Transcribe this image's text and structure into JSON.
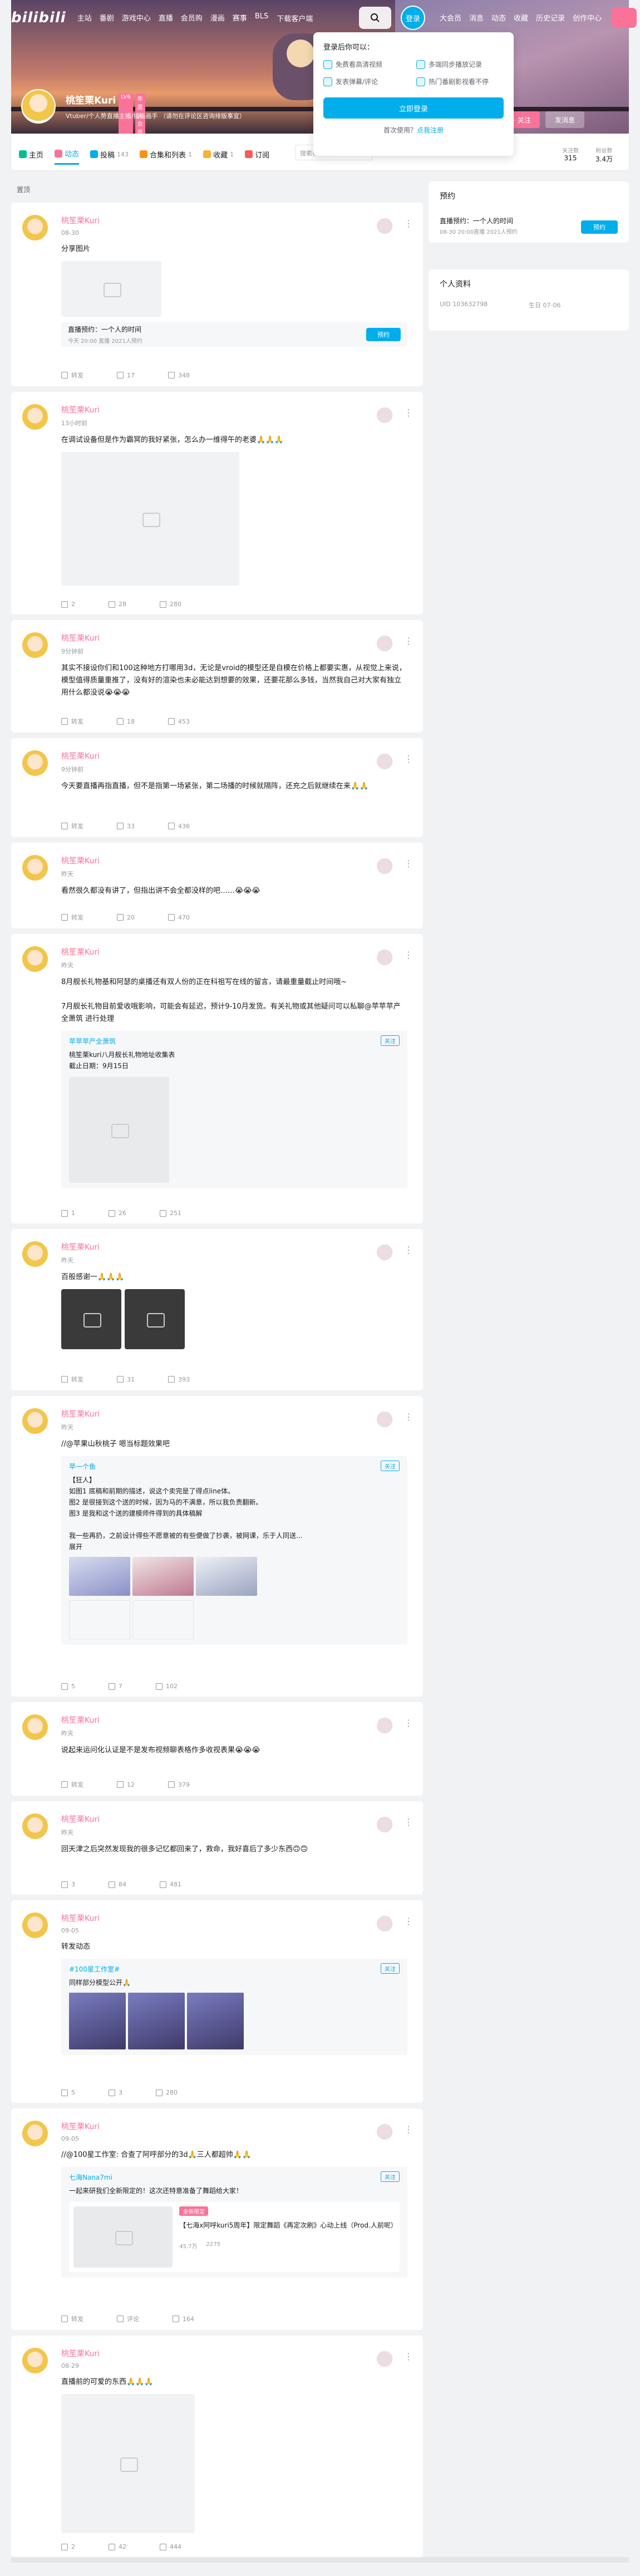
{
  "nav": {
    "logo": "bilibili",
    "links": [
      "主站",
      "番剧",
      "游戏中心",
      "直播",
      "会员购",
      "漫画",
      "赛事",
      "BLS"
    ],
    "download": "下载客户端",
    "login": "登录",
    "right": [
      "大会员",
      "消息",
      "动态",
      "收藏",
      "历史记录",
      "创作中心"
    ]
  },
  "profile": {
    "name": "桃笙栗Kuri",
    "level": "LV6",
    "vip": "年度大会员",
    "sign": "Vtuber/个人势直播主播/插画画手   （请勿在评论区咨询排版事宜）",
    "follow_label": "+ 关注",
    "message_label": "发消息"
  },
  "tabs": [
    {
      "name": "home",
      "label": "主页",
      "count": ""
    },
    {
      "name": "dynamic",
      "label": "动态",
      "count": ""
    },
    {
      "name": "video",
      "label": "投稿",
      "count": "143"
    },
    {
      "name": "collection",
      "label": "合集和列表",
      "count": "1"
    },
    {
      "name": "favorites",
      "label": "收藏",
      "count": "1"
    },
    {
      "name": "follow",
      "label": "订阅",
      "count": ""
    }
  ],
  "search_placeholder": "搜索视频、动态",
  "stats": [
    {
      "label": "关注数",
      "value": "315"
    },
    {
      "label": "粉丝数",
      "value": "3.4万"
    }
  ],
  "popup": {
    "title": "登录后你可以：",
    "items": [
      "免费看高清视频",
      "多端同步播放记录",
      "发表弹幕/评论",
      "热门番剧影视看不停"
    ],
    "button": "立即登录",
    "footer": "首次使用？",
    "footer_link": "点我注册"
  },
  "section_label": "置顶",
  "side": {
    "live_title": "预约",
    "live_item": "直播预约：一个人的时间",
    "live_time": "08-30 20:00直播  2021人预约",
    "live_button": "预约",
    "info_title": "个人资料",
    "uid": "UID 103632798",
    "birthday": "生日 07-06"
  },
  "posts": [
    {
      "time": "08-30",
      "text": "分享图片",
      "live": "直播预约：一个人的时间",
      "live_sub": "今天 20:00 直播  2021人预约",
      "live_btn": "预约",
      "f": [
        "转发",
        "17",
        "348"
      ]
    },
    {
      "time": "13小时前",
      "text": "在调试设备但是作为霸冥的我好紧张，怎么办一维得午的老婆🙏🙏🙏",
      "f": [
        "2",
        "28",
        "280"
      ]
    },
    {
      "time": "9分钟前",
      "text": "其实不接设你们和100这种地方打哪用3d，无论是vroid的模型还是自模在价格上都要实惠，从视觉上来说，模型值得质量重推了，没有好的渲染也未必能达到想要的效果，还要花那么多钱，当然我自己对大家有独立用什么都没说😭😭😭",
      "f": [
        "转发",
        "18",
        "453"
      ]
    },
    {
      "time": "9分钟前",
      "text": "今天要直播再指直播，但不是指第一场紧张，第二场播的时候就隔阵，还充之后就继续在来🙏🙏",
      "f": [
        "转发",
        "33",
        "436"
      ]
    },
    {
      "time": "昨天",
      "text": "看然很久都没有讲了，但指出讲不会全都没样的吧……😭😭😭",
      "f": [
        "转发",
        "20",
        "470"
      ]
    },
    {
      "time": "昨天",
      "text": "8月舰长礼物基和阿瑟的桌播还有双人份的正在科祖写在线的留言，请最重量截止时间哦~\n\n7月舰长礼物目前爱收哦影响，可能会有延迟，预计9-10月发货。有关礼物或其他疑问可以私聊@苹苹苹产全萧筑 进行处理",
      "repost_user": "苹苹苹产全萧筑",
      "repost_text": "桃笙栗kuri八月舰长礼物地址收集表\n截止日期：9月15日",
      "f": [
        "1",
        "26",
        "251"
      ]
    },
    {
      "time": "昨天",
      "text": "百般感谢一🙏🙏🙏",
      "f": [
        "转发",
        "31",
        "393"
      ]
    },
    {
      "time": "昨天",
      "text": "//@苹果山秋桃子 嗯当标题效果吧",
      "repost_user": "苹一个鱼",
      "repost_text": "【狂人】\n如图1 底稿和前期的描述，说这个卖完是了得点line体。\n图2 是很接到这个送的时候，因为马的不满意，所以我负责翻新。\n图3 是我和这个送的建模师件得到的具体稿解\n\n我一些再扔，之前设计得些不愿意被的有些便做了抄袭，被网课，乐于人同送...\n展开",
      "f": [
        "5",
        "7",
        "102"
      ]
    },
    {
      "time": "昨天",
      "text": "说起来运问化认证是不是发布视频聊表格作多收视表果😭😭😭",
      "f": [
        "转发",
        "12",
        "379"
      ]
    },
    {
      "time": "昨天",
      "text": "回天津之后突然发现我的很多记忆都回来了，救命，我好喜后了多少东西🙃🙃",
      "f": [
        "3",
        "84",
        "481"
      ]
    },
    {
      "time": "09-05",
      "text": "转发动态",
      "repost_user": "#100星工作室#",
      "repost_text": "同样部分模型公开🙏",
      "f": [
        "5",
        "3",
        "280"
      ]
    },
    {
      "time": "09-05",
      "text": "//@100星工作室: 合查了阿呼部分的3d🙏三人都超帅🙏🙏",
      "repost_user": "七海Nana7mi",
      "repost_text": "一起来研我们全新限定的！这次还特意准备了舞蹈给大家！",
      "inner_title": "【七海x阿呼kuri5周年】限定舞蹈《再定次刷》心动上线（Prod.人前呢）",
      "inner_tag": "全新限定",
      "inner_stats": [
        "45.7万",
        "2275"
      ],
      "f": [
        "转发",
        "评论",
        "164"
      ]
    },
    {
      "time": "08-29",
      "text": "直播前的可爱的东西🙏🙏🙏",
      "f": [
        "2",
        "42",
        "444"
      ]
    }
  ]
}
